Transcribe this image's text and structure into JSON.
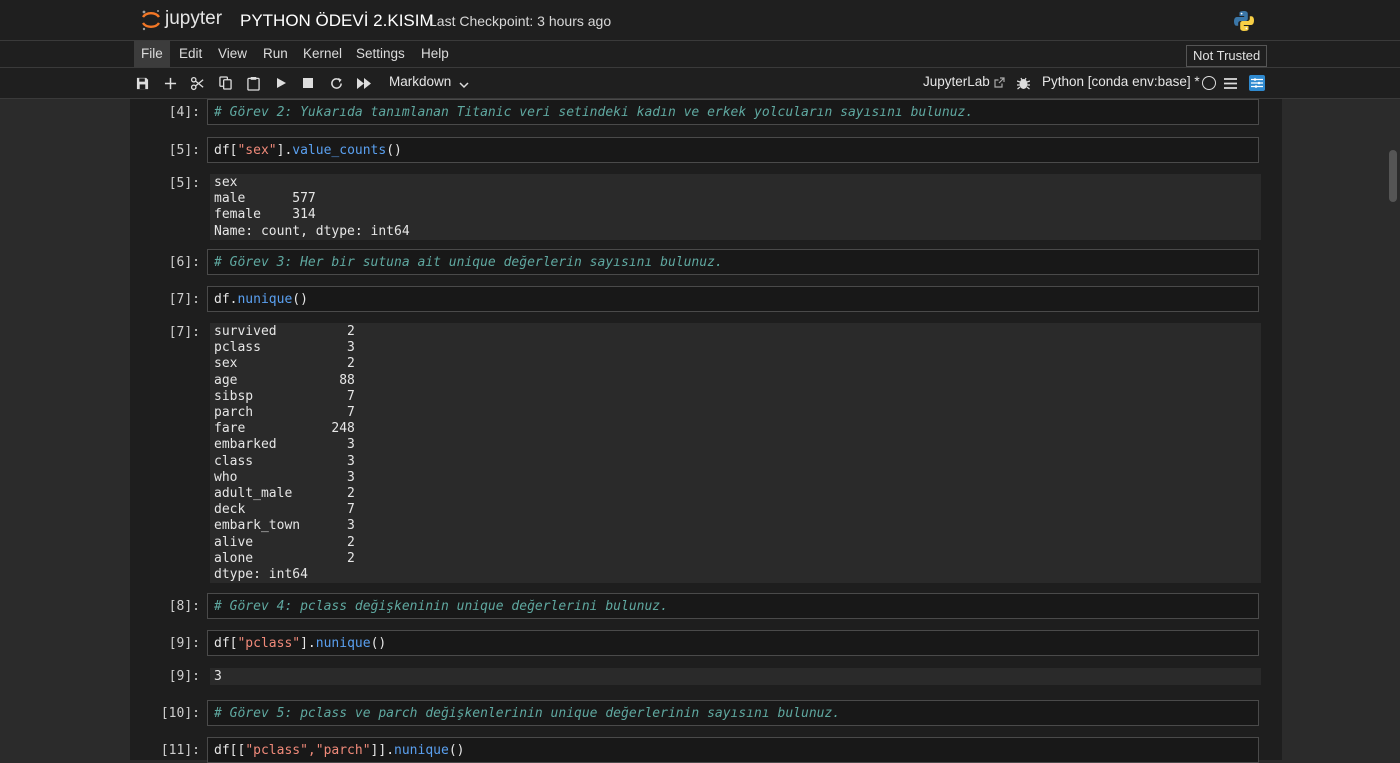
{
  "app": {
    "logo_text": "jupyter",
    "notebook_title": "PYTHON ÖDEVİ 2.KISIM",
    "checkpoint": "Last Checkpoint: 3 hours ago"
  },
  "menu": [
    "File",
    "Edit",
    "View",
    "Run",
    "Kernel",
    "Settings",
    "Help"
  ],
  "trusted": "Not Trusted",
  "toolbar": {
    "cell_type": "Markdown",
    "jupyterlab": "JupyterLab",
    "kernel": "Python [conda env:base] *"
  },
  "cells": {
    "c4": {
      "prompt": "[4]:",
      "text": "# Görev 2: Yukarıda tanımlanan Titanic veri setindeki kadın ve erkek yolcuların sayısını bulunuz."
    },
    "c5": {
      "prompt": "[5]:",
      "code_df": "df[",
      "code_str": "\"sex\"",
      "code_mid": "].",
      "code_fn": "value_counts",
      "code_end": "()",
      "out_prompt": "[5]:",
      "output": "sex\nmale      577\nfemale    314\nName: count, dtype: int64"
    },
    "c6": {
      "prompt": "[6]:",
      "text": "# Görev 3: Her bir sutuna ait unique değerlerin sayısını bulunuz."
    },
    "c7": {
      "prompt": "[7]:",
      "code_df": "df.",
      "code_fn": "nunique",
      "code_end": "()",
      "out_prompt": "[7]:",
      "output": "survived         2\npclass           3\nsex              2\nage             88\nsibsp            7\nparch            7\nfare           248\nembarked         3\nclass            3\nwho              3\nadult_male       2\ndeck             7\nembark_town      3\nalive            2\nalone            2\ndtype: int64"
    },
    "c8": {
      "prompt": "[8]:",
      "text": "# Görev 4: pclass değişkeninin unique değerlerini bulunuz."
    },
    "c9": {
      "prompt": "[9]:",
      "code_df": "df[",
      "code_str": "\"pclass\"",
      "code_mid": "].",
      "code_fn": "nunique",
      "code_end": "()",
      "out_prompt": "[9]:",
      "output": "3"
    },
    "c10": {
      "prompt": "[10]:",
      "text": "# Görev 5: pclass ve parch değişkenlerinin unique değerlerinin sayısını bulunuz."
    },
    "c11": {
      "prompt": "[11]:",
      "code_df": "df[[",
      "code_str": "\"pclass\",\"parch\"",
      "code_mid": "]].",
      "code_fn": "nunique",
      "code_end": "()"
    }
  }
}
